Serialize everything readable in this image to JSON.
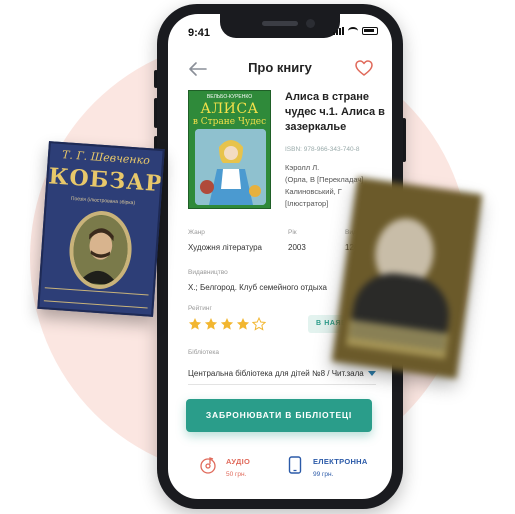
{
  "status": {
    "time": "9:41"
  },
  "header": {
    "title": "Про книгу"
  },
  "book": {
    "cover": {
      "publisher": "ВЕЛЬБО-КУРЕНКО",
      "title": "АЛИСА",
      "subtitle": "в Стране Чудес"
    },
    "title": "Алиса в стране чудес ч.1. Алиса в зазеркалье",
    "isbn": "ISBN: 978-966-343-740-8",
    "authors": [
      "Кэролл Л.",
      "(Орла,  В [Перекладач]",
      "Калиновський, Г",
      "[Ілюстратор]"
    ]
  },
  "meta": {
    "genre_label": "Жанр",
    "genre": "Художня література",
    "year_label": "Рік",
    "year": "2003",
    "pages_label": "Видання",
    "pages": "1245",
    "publisher_label": "Видавництво",
    "publisher": "Х.; Белгород. Клуб семейного отдыха",
    "rating_label": "Рейтинг",
    "rating": 4,
    "rating_max": 5,
    "availability": "В НАЯВНОСТІ",
    "library_label": "Бібліотека",
    "library": "Центральна бібліотека для дітей №8 / Чит.зала"
  },
  "actions": {
    "reserve": "ЗАБРОНЮВАТИ В БІБЛІОТЕЦІ"
  },
  "formats": [
    {
      "name": "АУДІО",
      "price": "50 грн.",
      "color": "#e06a5b",
      "icon": "audio-disc-icon"
    },
    {
      "name": "ЕЛЕКТРОННА",
      "price": "99 грн.",
      "color": "#2b5aa8",
      "icon": "phone-device-icon"
    }
  ],
  "floating_books": {
    "left": {
      "author": "Т. Г. Шевченко",
      "title": "КОБЗАР",
      "subtitle": "Поезія (ілюстрована збірка)"
    }
  },
  "colors": {
    "accent": "#2a9d8a",
    "background_circle": "#fbe6e1",
    "heart": "#e06a5b"
  }
}
